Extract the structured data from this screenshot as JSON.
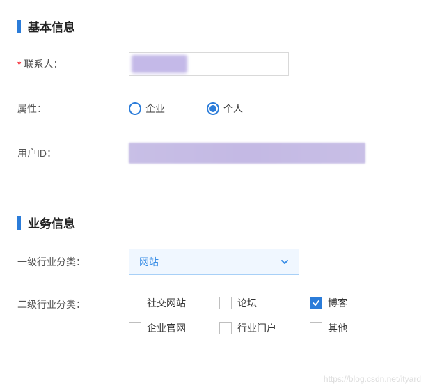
{
  "sections": {
    "basic": {
      "title": "基本信息",
      "contact": {
        "label": "联系人：",
        "value": "",
        "required": true
      },
      "attribute": {
        "label": "属性：",
        "options": [
          {
            "label": "企业",
            "value": "enterprise",
            "checked": false
          },
          {
            "label": "个人",
            "value": "personal",
            "checked": true
          }
        ]
      },
      "userid": {
        "label": "用户ID：",
        "value": ""
      }
    },
    "business": {
      "title": "业务信息",
      "primary_category": {
        "label": "一级行业分类：",
        "selected": "网站"
      },
      "secondary_category": {
        "label": "二级行业分类：",
        "options": [
          {
            "label": "社交网站",
            "checked": false
          },
          {
            "label": "论坛",
            "checked": false
          },
          {
            "label": "博客",
            "checked": true
          },
          {
            "label": "企业官网",
            "checked": false
          },
          {
            "label": "行业门户",
            "checked": false
          },
          {
            "label": "其他",
            "checked": false
          }
        ]
      }
    }
  },
  "watermark": "https://blog.csdn.net/ityard"
}
